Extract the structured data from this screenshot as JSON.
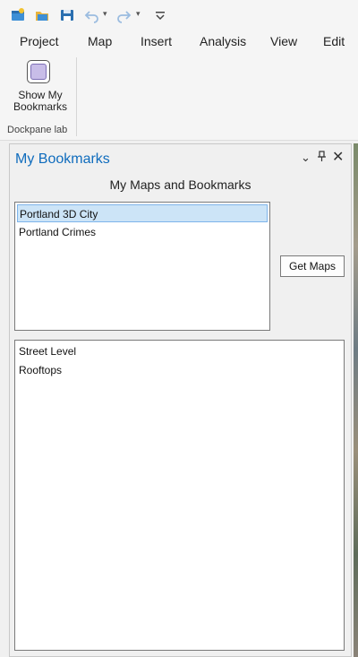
{
  "quick_access": {
    "items": [
      "new-project-icon",
      "open-project-icon",
      "save-project-icon",
      "undo-icon",
      "redo-icon",
      "customize-icon"
    ]
  },
  "menu_tabs": [
    "Project",
    "Map",
    "Insert",
    "Analysis",
    "View",
    "Edit"
  ],
  "ribbon": {
    "button_line1": "Show My",
    "button_line2": "Bookmarks",
    "group_label": "Dockpane lab"
  },
  "pane": {
    "title": "My Bookmarks",
    "subtitle": "My Maps and Bookmarks",
    "maps": [
      {
        "label": "Portland 3D City",
        "selected": true
      },
      {
        "label": "Portland Crimes",
        "selected": false
      }
    ],
    "get_maps_label": "Get Maps",
    "bookmarks": [
      "Street Level",
      "Rooftops"
    ]
  },
  "colors": {
    "accent": "#0f6cbd",
    "selection": "#cce4f7"
  }
}
